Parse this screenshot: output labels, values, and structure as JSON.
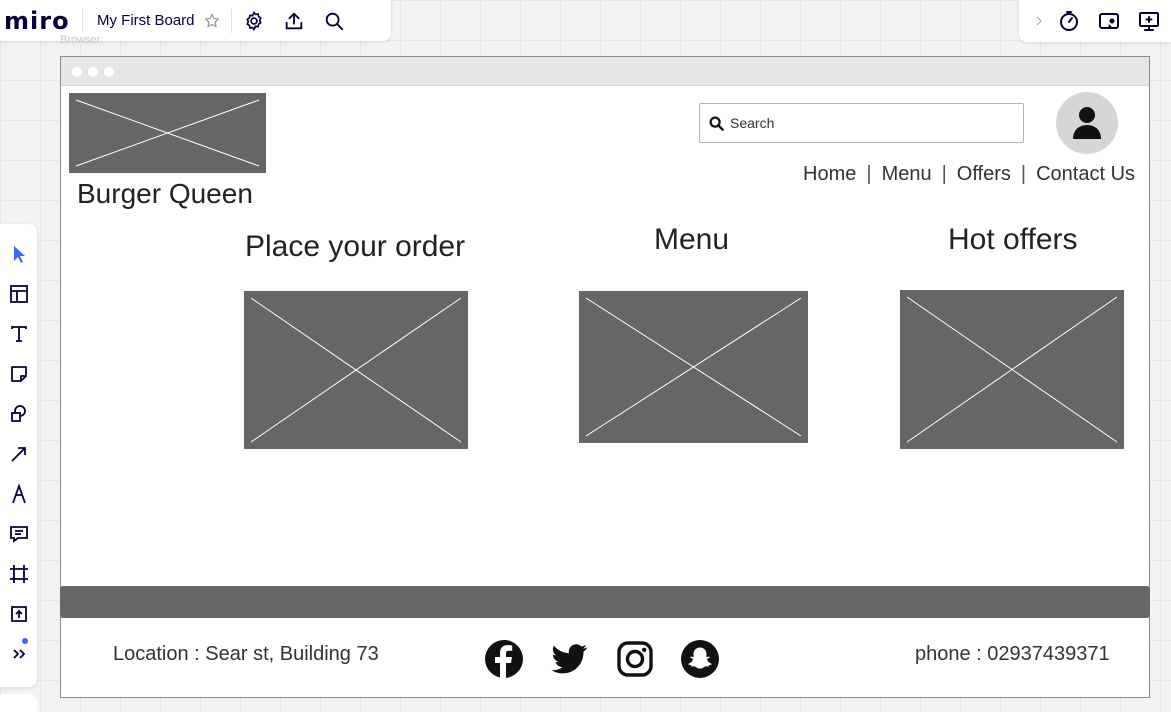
{
  "miro": {
    "logo": "miro",
    "board_name": "My First Board",
    "frame_label": "Browser"
  },
  "wireframe": {
    "brand_name": "Burger Queen",
    "search": {
      "placeholder": "Search"
    },
    "nav": [
      "Home",
      "Menu",
      "Offers",
      "Contact Us"
    ],
    "nav_separator": "|",
    "sections": [
      {
        "title": "Place your order"
      },
      {
        "title": "Menu"
      },
      {
        "title": "Hot offers"
      }
    ],
    "footer": {
      "location": "Location : Sear st, Building 73",
      "phone": "phone : 02937439371",
      "social_icons": [
        "facebook-icon",
        "twitter-icon",
        "instagram-icon",
        "snapchat-icon"
      ]
    }
  },
  "colors": {
    "placeholder_fill": "#666666",
    "miro_accent": "#4262ff",
    "miro_text": "#050038"
  }
}
